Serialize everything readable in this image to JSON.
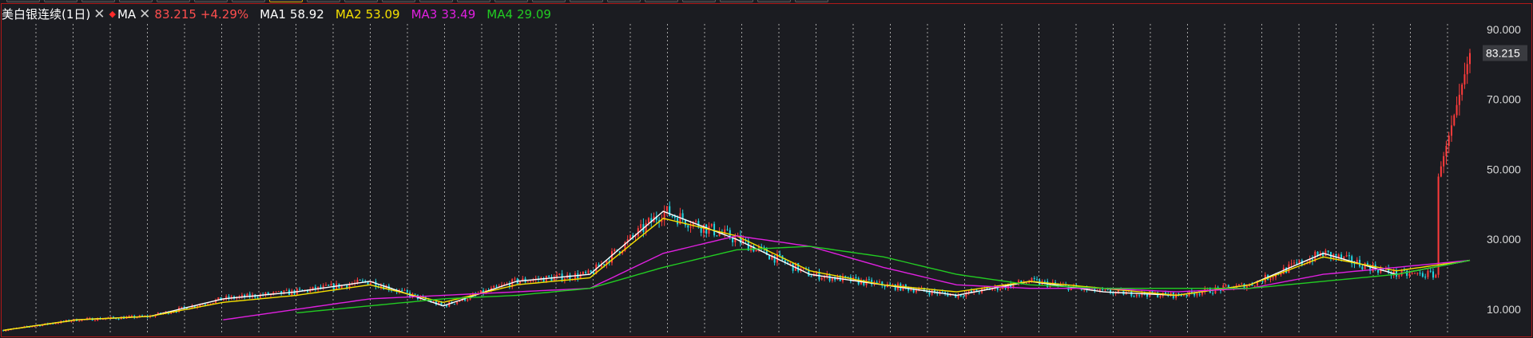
{
  "legend": {
    "title": "美白银连续(1日)",
    "ma_label": "MA",
    "price": "83.215",
    "change": "+4.29%",
    "ma1": {
      "label": "MA1",
      "value": "58.92",
      "color": "#ffffff"
    },
    "ma2": {
      "label": "MA2",
      "value": "53.09",
      "color": "#f5e000"
    },
    "ma3": {
      "label": "MA3",
      "value": "33.49",
      "color": "#e020e0"
    },
    "ma4": {
      "label": "MA4",
      "value": "29.09",
      "color": "#22cc22"
    },
    "price_color": "#ff4e4e"
  },
  "colors": {
    "up": "#ff3b3b",
    "down": "#21d4e0",
    "grid": "#bcbcbc",
    "frame": "#b01818",
    "background": "#1b1c21"
  },
  "chart_data": {
    "type": "line",
    "title": "美白银连续(1日)",
    "y_ticks": [
      "90.000",
      "70.000",
      "50.000",
      "30.000",
      "10.000"
    ],
    "ylim": [
      5,
      92
    ],
    "last_price_label": "83.215",
    "x": [
      0,
      5,
      10,
      15,
      20,
      25,
      30,
      35,
      40,
      45,
      50,
      55,
      60,
      65,
      70,
      75,
      80,
      85,
      90,
      95,
      100
    ],
    "series": [
      {
        "name": "MA1",
        "values": [
          4,
          7,
          8,
          13,
          15,
          18,
          11,
          18,
          20,
          38,
          30,
          20,
          17,
          14,
          18,
          15,
          14,
          17,
          26,
          20,
          24,
          58.92
        ]
      },
      {
        "name": "MA2",
        "values": [
          4,
          7,
          8,
          12,
          14,
          17,
          12,
          17,
          19,
          36,
          31,
          21,
          17,
          15,
          18,
          16,
          14,
          17,
          25,
          21,
          24,
          53.09
        ]
      }
    ],
    "x_full": [
      0,
      5,
      10,
      15,
      20,
      25,
      30,
      35,
      40,
      45,
      50,
      55,
      60,
      65,
      70,
      75,
      80,
      85,
      90,
      95,
      100
    ],
    "close": [
      4,
      7,
      8,
      13,
      15,
      18,
      11,
      18,
      20,
      38,
      30,
      20,
      17,
      14,
      18,
      15,
      14,
      17,
      26,
      20,
      24,
      83.215
    ],
    "ma3": [
      null,
      null,
      null,
      7,
      10,
      13,
      14,
      15,
      16,
      26,
      31,
      28,
      22,
      17,
      16,
      16,
      15,
      16,
      20,
      22,
      24,
      33.49
    ],
    "ma4": [
      null,
      null,
      null,
      null,
      9,
      11,
      13,
      14,
      16,
      22,
      27,
      28,
      25,
      20,
      17,
      16,
      16,
      16,
      18,
      20,
      24,
      29.09
    ]
  }
}
